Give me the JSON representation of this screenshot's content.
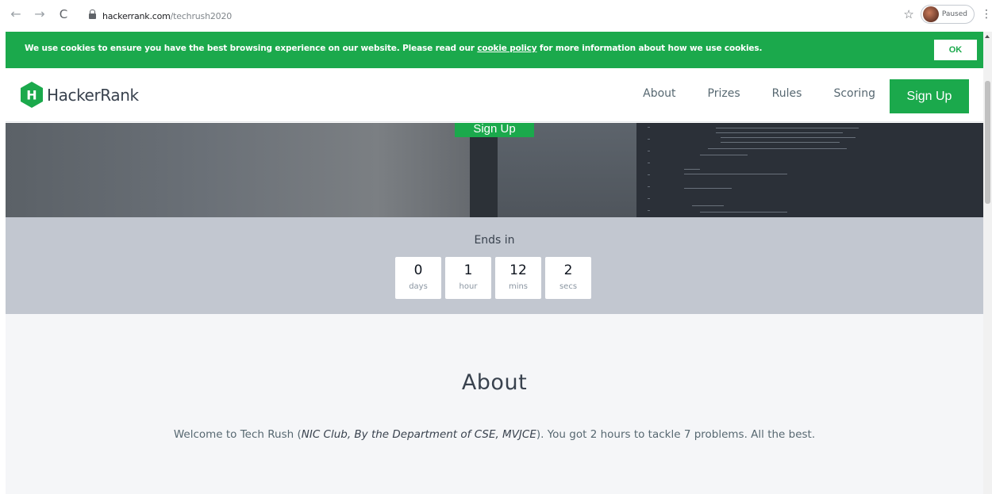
{
  "browser": {
    "url_domain": "hackerrank.com",
    "url_path": "/techrush2020",
    "profile_label": "Paused",
    "back_glyph": "←",
    "forward_glyph": "→",
    "reload_glyph": "C",
    "star_glyph": "☆",
    "menu_glyph": "⋮"
  },
  "cookie_banner": {
    "text_before": "We use cookies to ensure you have the best browsing experience on our website. Please read our ",
    "link": "cookie policy",
    "text_after": " for more information about how we use cookies.",
    "ok_label": "OK"
  },
  "header": {
    "logo_letter": "H",
    "logo_name": "HackerRank",
    "nav": [
      "About",
      "Prizes",
      "Rules",
      "Scoring"
    ],
    "signup_label": "Sign Up"
  },
  "hero": {
    "signup_label": "Sign Up"
  },
  "countdown": {
    "title": "Ends in",
    "items": [
      {
        "value": "0",
        "unit": "days"
      },
      {
        "value": "1",
        "unit": "hour"
      },
      {
        "value": "12",
        "unit": "mins"
      },
      {
        "value": "2",
        "unit": "secs"
      }
    ]
  },
  "about": {
    "heading": "About",
    "text_before": "Welcome to Tech Rush (",
    "emphasis": "NIC Club, By the Department of CSE, MVJCE",
    "text_after": "). You got 2 hours to tackle 7 problems. All the best."
  },
  "colors": {
    "brand_green": "#1ba94c",
    "countdown_bg": "#c2c7d0",
    "about_bg": "#f5f6f8"
  }
}
